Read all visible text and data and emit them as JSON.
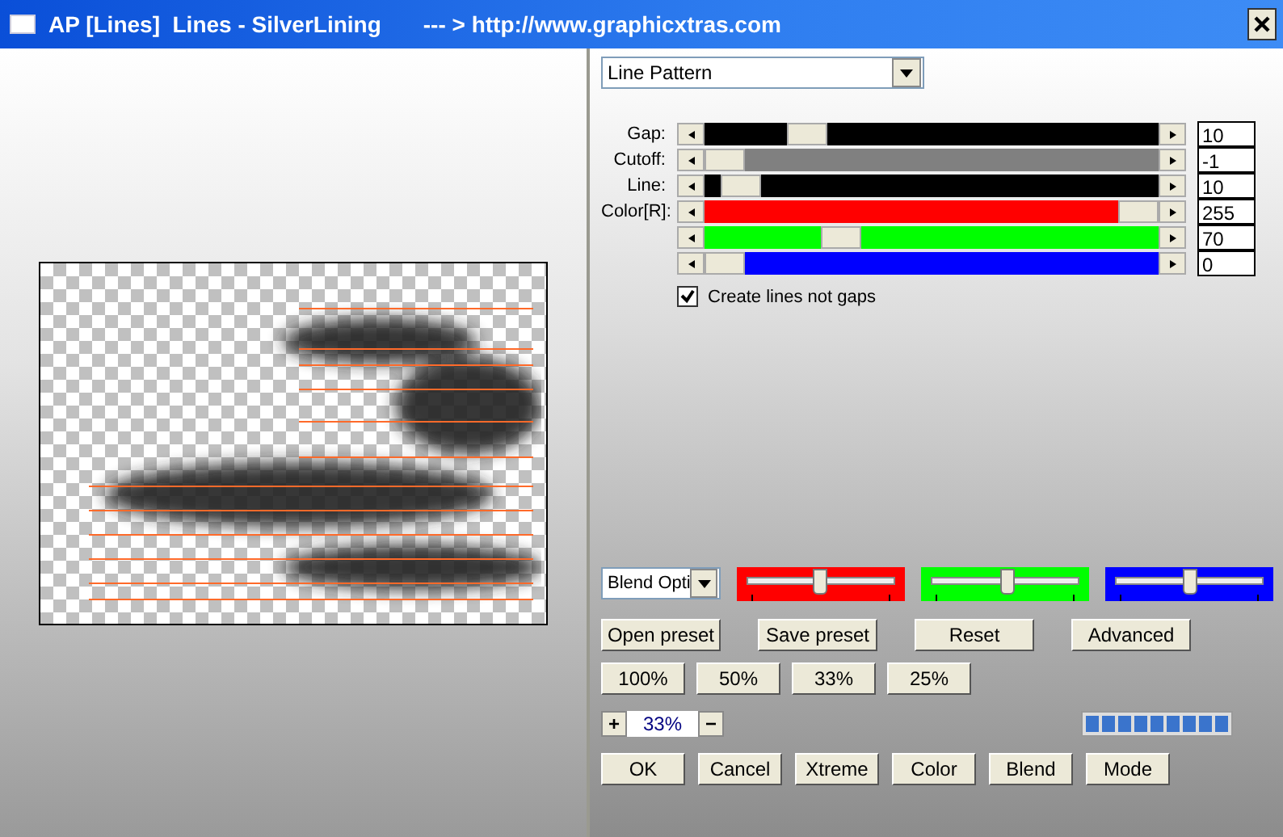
{
  "window": {
    "title": "AP [Lines]  Lines - SilverLining",
    "url": "--- > http://www.graphicxtras.com"
  },
  "pattern_select": {
    "value": "Line Pattern"
  },
  "sliders": [
    {
      "label": "Gap:",
      "level": 0.2,
      "value": "10",
      "color": "#000000"
    },
    {
      "label": "Cutoff:",
      "level": 0,
      "value": "-1",
      "color": "#808080"
    },
    {
      "label": "Line:",
      "level": 0.04,
      "value": "10",
      "color": "#000000"
    },
    {
      "label": "Color[R]:",
      "level": 1,
      "value": "255",
      "color": "#ff0000"
    },
    {
      "level": 0.28,
      "value": "70",
      "color": "#00ff00"
    },
    {
      "level": 0,
      "value": "0",
      "color": "#0000ff"
    }
  ],
  "create_lines_checkbox": {
    "label": "Create lines not gaps",
    "checked": true
  },
  "blend_select": {
    "value": "Blend Opti"
  },
  "blend_trackbars": [
    {
      "color": "#ff0000",
      "level": 0.49
    },
    {
      "color": "#00ff00",
      "level": 0.51
    },
    {
      "color": "#0000ff",
      "level": 0.5
    }
  ],
  "preset_buttons": [
    "Open preset",
    "Save preset",
    "Reset",
    "Advanced"
  ],
  "zoom_buttons": [
    "100%",
    "50%",
    "33%",
    "25%"
  ],
  "zoom_stepper": {
    "plus": "+",
    "value": "33%",
    "minus": "−"
  },
  "action_buttons": [
    "OK",
    "Cancel",
    "Xtreme",
    "Color",
    "Blend",
    "Mode"
  ]
}
